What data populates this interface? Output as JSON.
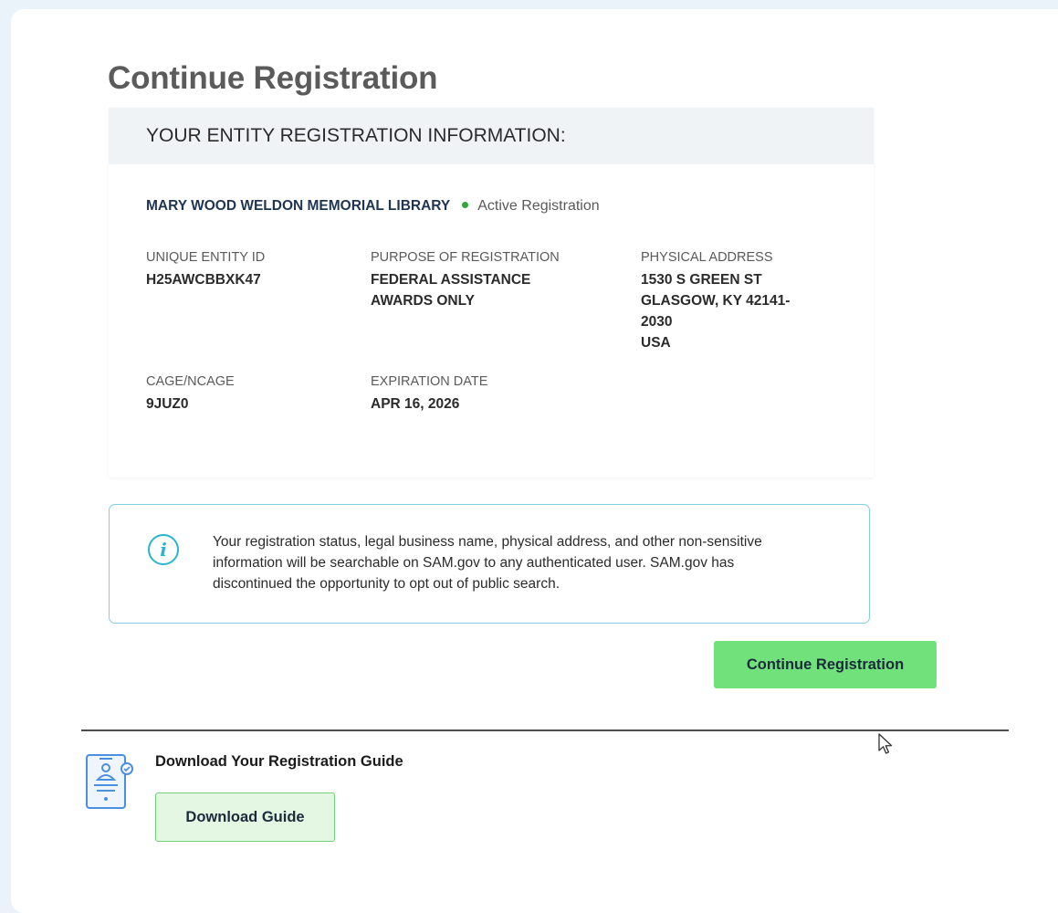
{
  "page": {
    "title": "Continue Registration"
  },
  "entity_card": {
    "header": "YOUR ENTITY REGISTRATION INFORMATION:",
    "entity_name": "MARY WOOD WELDON MEMORIAL LIBRARY",
    "status": {
      "label": "Active Registration",
      "color": "#2fa836"
    },
    "fields": {
      "unique_entity_id": {
        "label": "UNIQUE ENTITY ID",
        "value": "H25AWCBBXK47"
      },
      "purpose": {
        "label": "PURPOSE OF REGISTRATION",
        "value_lines": [
          "FEDERAL ASSISTANCE",
          "AWARDS ONLY"
        ]
      },
      "physical_address": {
        "label": "PHYSICAL ADDRESS",
        "value_lines": [
          "1530 S GREEN ST",
          "GLASGOW, KY 42141-",
          "2030",
          "USA"
        ]
      },
      "cage": {
        "label": "CAGE/NCAGE",
        "value": "9JUZ0"
      },
      "expiration": {
        "label": "EXPIRATION DATE",
        "value": "APR 16, 2026"
      }
    }
  },
  "info_alert": {
    "icon": "info-icon",
    "text": "Your registration status, legal business name, physical address, and other non-sensitive information will be searchable on SAM.gov to any authenticated user. SAM.gov has discontinued the opportunity to opt out of public search."
  },
  "actions": {
    "continue_label": "Continue Registration"
  },
  "guide": {
    "icon": "registration-guide-icon",
    "title": "Download Your Registration Guide",
    "button_label": "Download Guide"
  },
  "colors": {
    "primary_button": "#70e17b",
    "secondary_button_bg": "#e3f7e3",
    "alert_border": "#7fd0e0",
    "info_icon": "#28b6cc",
    "header_bg": "#f0f3f6"
  }
}
